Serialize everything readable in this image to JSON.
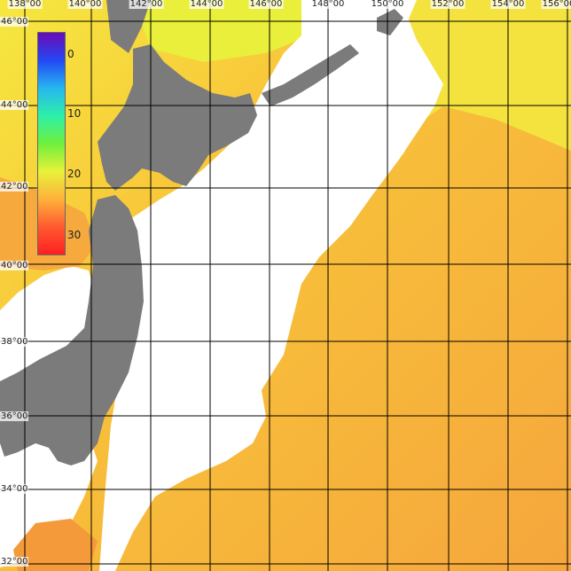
{
  "map": {
    "lon_labels": [
      "138°00",
      "140°00",
      "142°00",
      "144°00",
      "146°00",
      "148°00",
      "150°00",
      "152°00",
      "154°00",
      "156°00"
    ],
    "lat_labels": [
      "46°00",
      "44°00",
      "42°00",
      "40°00",
      "38°00",
      "36°00",
      "34°00",
      "32°00"
    ],
    "colors": {
      "land": "#7b7b7b",
      "no_data": "#ffffff",
      "grid": "#000000",
      "warm_sea": "#f5a63c",
      "mid_sea": "#f8c43a",
      "cool_sea": "#f6e83f"
    }
  },
  "legend": {
    "ticks": [
      "0",
      "10",
      "20",
      "30"
    ],
    "gradient_colors": [
      "#6a0bb5",
      "#2348f4",
      "#26b7f0",
      "#2df0a8",
      "#6ff03c",
      "#e7f23a",
      "#ffb13a",
      "#ff5a30",
      "#ff2020"
    ]
  }
}
